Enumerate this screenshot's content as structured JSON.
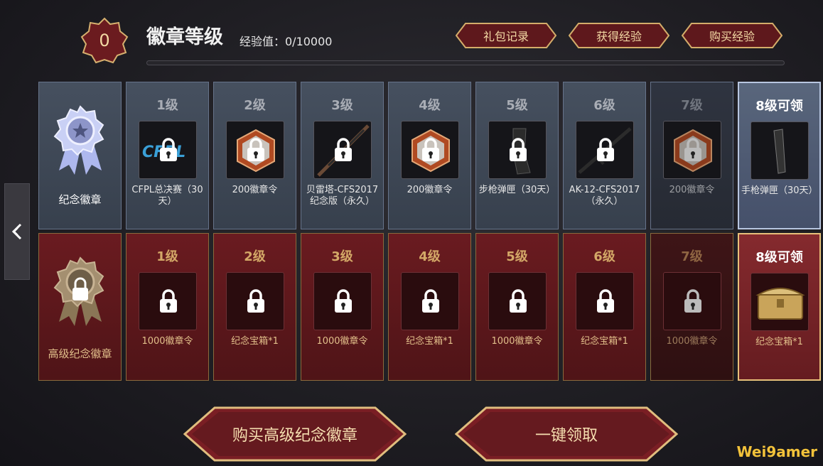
{
  "header": {
    "level": "0",
    "title": "徽章等级",
    "exp_text": "经验值：0/10000",
    "exp_progress": 0,
    "buttons": [
      "礼包记录",
      "获得经验",
      "购买经验"
    ]
  },
  "colors": {
    "gold": "#f3d9a4",
    "basic_card": "#3f4856",
    "advanced_card": "#5d181c",
    "button_red": "#6b1e23"
  },
  "basic_row": {
    "title": "纪念徽章",
    "rewards": [
      {
        "level": "1级",
        "name": "CFPL总决赛（30天）",
        "icon": "cfpl-logo"
      },
      {
        "level": "2级",
        "name": "200徽章令",
        "icon": "badge-token"
      },
      {
        "level": "3级",
        "name": "贝雷塔-CFS2017纪念版（永久）",
        "icon": "rifle"
      },
      {
        "level": "4级",
        "name": "200徽章令",
        "icon": "badge-token"
      },
      {
        "level": "5级",
        "name": "步枪弹匣（30天）",
        "icon": "magazine"
      },
      {
        "level": "6级",
        "name": "AK-12-CFS2017（永久）",
        "icon": "rifle"
      },
      {
        "level": "7级",
        "name": "200徽章令",
        "icon": "badge-token"
      },
      {
        "level": "8级可领",
        "name": "手枪弹匣（30天）",
        "icon": "pistol-magazine"
      }
    ]
  },
  "advanced_row": {
    "title": "高级纪念徽章",
    "rewards": [
      {
        "level": "1级",
        "name": "1000徽章令"
      },
      {
        "level": "2级",
        "name": "纪念宝箱*1"
      },
      {
        "level": "3级",
        "name": "1000徽章令"
      },
      {
        "level": "4级",
        "name": "纪念宝箱*1"
      },
      {
        "level": "5级",
        "name": "1000徽章令"
      },
      {
        "level": "6级",
        "name": "纪念宝箱*1"
      },
      {
        "level": "7级",
        "name": "1000徽章令"
      },
      {
        "level": "8级可领",
        "name": "纪念宝箱*1",
        "icon": "treasure-chest"
      }
    ]
  },
  "bottom": {
    "buy_button": "购买高级纪念徽章",
    "claim_button": "一键领取"
  },
  "watermark": "Wei9amer"
}
